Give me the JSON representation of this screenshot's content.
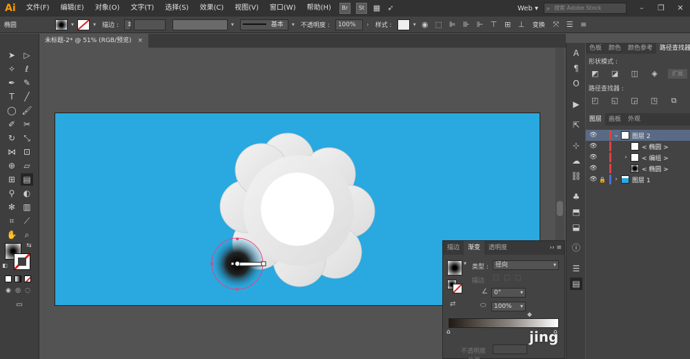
{
  "app": {
    "logo": "Ai"
  },
  "menu": {
    "items": [
      "文件(F)",
      "编辑(E)",
      "对象(O)",
      "文字(T)",
      "选择(S)",
      "效果(C)",
      "视图(V)",
      "窗口(W)",
      "帮助(H)"
    ],
    "bridge": "Br",
    "stock": "St",
    "workspace": "Web",
    "search_placeholder": "搜索 Adobe Stock"
  },
  "control": {
    "object_type": "椭圆",
    "stroke_label": "描边 :",
    "brush_label": "基本",
    "opacity_label": "不透明度 :",
    "opacity_value": "100%",
    "style_label": "样式 :",
    "transform_label": "变换"
  },
  "document": {
    "tab_title": "未标题-2* @ 51% (RGB/预览)",
    "close": "×"
  },
  "panels": {
    "tabs_top": [
      "色板",
      "颜色",
      "颜色参考",
      "路径查找器"
    ],
    "shape_modes_label": "形状模式 :",
    "pathfinder_label": "路径查找器 :",
    "expand_label": "扩展",
    "tabs_layers": [
      "图层",
      "画板",
      "外观"
    ],
    "layers": [
      {
        "name": "图层 2",
        "level": 0,
        "expanded": true,
        "color": "#e04040",
        "selected": true
      },
      {
        "name": "< 椭圆 >",
        "level": 1,
        "color": "#e04040"
      },
      {
        "name": "< 编组 >",
        "level": 1,
        "color": "#e04040",
        "collapsed": true
      },
      {
        "name": "< 椭圆 >",
        "level": 1,
        "color": "#e04040"
      },
      {
        "name": "图层 1",
        "level": 0,
        "color": "#4a6fd8",
        "locked": true
      }
    ]
  },
  "gradient_panel": {
    "tabs": [
      "描边",
      "渐变",
      "透明度"
    ],
    "type_label": "类型 :",
    "type_value": "径向",
    "stroke_label": "描边",
    "angle_value": "0°",
    "aspect_value": "100%",
    "opacity_label": "不透明度",
    "location_label": "位置"
  },
  "watermark": "jing",
  "colors": {
    "artboard": "#29a9e0",
    "accent": "#ff9a00"
  }
}
